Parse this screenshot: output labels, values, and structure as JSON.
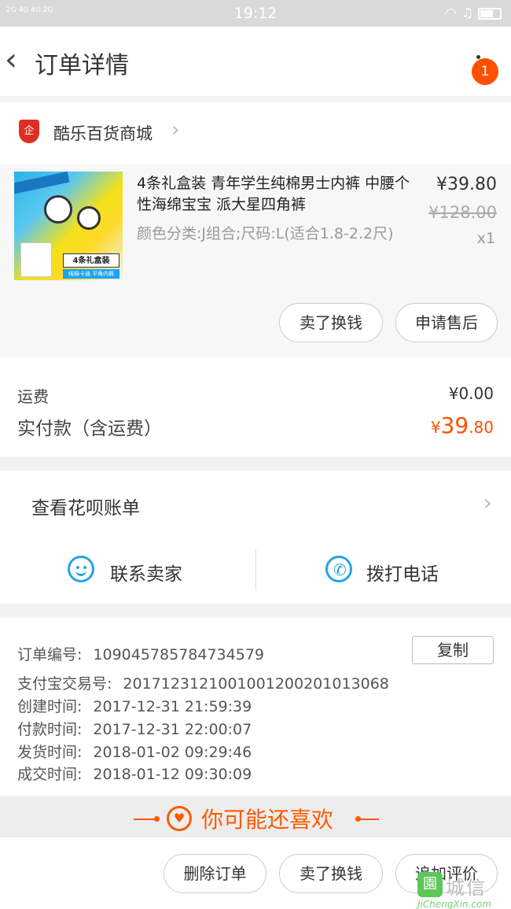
{
  "status_bar": {
    "signal1": "2G",
    "signal2": "4G 4G\n2G",
    "time": "19:12"
  },
  "nav": {
    "title": "订单详情",
    "badge": "1"
  },
  "shop": {
    "name": "酷乐百货商城",
    "logo_text": "企"
  },
  "item": {
    "title": "4条礼盒装 青年学生纯棉男士内裤 中腰个性海绵宝宝 派大星四角裤",
    "spec": "颜色分类:J组合;尺码:L(适合1.8-2.2尺)",
    "price": "¥39.80",
    "original_price": "¥128.00",
    "quantity": "x1",
    "image_tag": "4条礼盒装",
    "image_tag2": "纯棉卡通  平角内裤",
    "buttons": {
      "sell": "卖了换钱",
      "after_sale": "申请售后"
    }
  },
  "fees": {
    "shipping_label": "运费",
    "shipping_value": "¥0.00",
    "total_label": "实付款（含运费）",
    "total_symbol": "¥",
    "total_int": "39",
    "total_dec": ".80"
  },
  "huabei": {
    "label": "查看花呗账单"
  },
  "contact": {
    "seller": "联系卖家",
    "phone": "拨打电话"
  },
  "order_info": {
    "copy_label": "复制",
    "rows": [
      {
        "k": "订单编号:",
        "v": "109045785784734579"
      },
      {
        "k": "支付宝交易号:",
        "v": "2017123121001001200201013068"
      },
      {
        "k": "创建时间:",
        "v": "2017-12-31 21:59:39"
      },
      {
        "k": "付款时间:",
        "v": "2017-12-31 22:00:07"
      },
      {
        "k": "发货时间:",
        "v": "2018-01-02 09:29:46"
      },
      {
        "k": "成交时间:",
        "v": "2018-01-12 09:30:09"
      }
    ]
  },
  "recommend": {
    "text": "你可能还喜欢"
  },
  "bottom": {
    "delete": "删除订单",
    "sell": "卖了换钱",
    "review": "追加评价"
  },
  "watermark": {
    "mark": "園",
    "text": "城信",
    "url": "JiChengXin.com"
  },
  "colors": {
    "accent": "#ff5000",
    "blue": "#26a3e8",
    "shop_logo": "#e02e24"
  }
}
